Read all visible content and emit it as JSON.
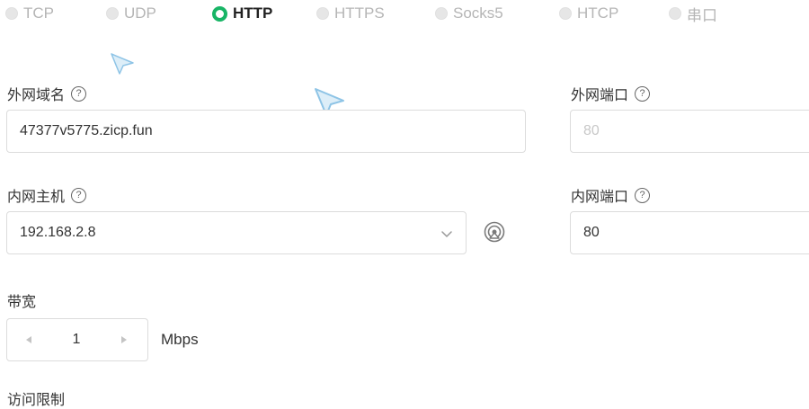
{
  "protocols": [
    {
      "label": "TCP",
      "selected": false
    },
    {
      "label": "UDP",
      "selected": false
    },
    {
      "label": "HTTP",
      "selected": true
    },
    {
      "label": "HTTPS",
      "selected": false
    },
    {
      "label": "Socks5",
      "selected": false
    },
    {
      "label": "HTCP",
      "selected": false
    },
    {
      "label": "串口",
      "selected": false
    }
  ],
  "colors": {
    "accent": "#18b566",
    "border": "#dcdcdc",
    "muted": "#b5b5b5"
  },
  "external_domain": {
    "label": "外网域名",
    "help_icon": "question-circle-icon",
    "help_glyph": "?",
    "value": "47377v5775.zicp.fun"
  },
  "external_port": {
    "label": "外网端口",
    "help_icon": "question-circle-icon",
    "help_glyph": "?",
    "placeholder": "80",
    "disabled": true
  },
  "internal_host": {
    "label": "内网主机",
    "help_icon": "question-circle-icon",
    "help_glyph": "?",
    "value": "192.168.2.8",
    "dropdown_icon": "chevron-down-icon",
    "scan_icon": "scan-network-icon"
  },
  "internal_port": {
    "label": "内网端口",
    "help_icon": "question-circle-icon",
    "help_glyph": "?",
    "value": "80"
  },
  "bandwidth": {
    "label": "带宽",
    "value": "1",
    "unit": "Mbps",
    "decrement_icon": "triangle-left-icon",
    "increment_icon": "triangle-right-icon"
  },
  "access_limit": {
    "label": "访问限制"
  }
}
